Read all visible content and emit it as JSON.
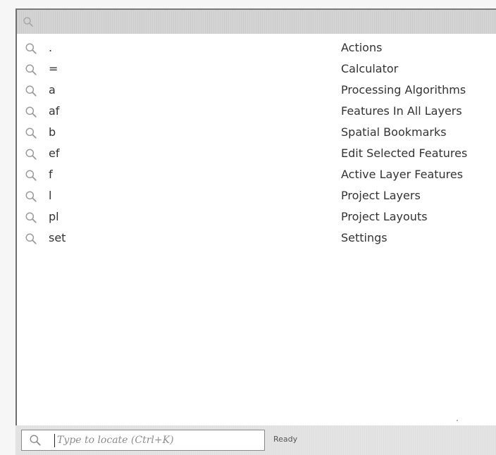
{
  "locator": {
    "placeholder": "Type to locate (Ctrl+K)",
    "value": ""
  },
  "status": {
    "text": "Ready"
  },
  "icons": {
    "search": "search-icon"
  },
  "colors": {
    "text": "#333333",
    "search_icon": "#9a9a9a",
    "header_strip": "#d4d4d4"
  },
  "filters": [
    {
      "prefix": ".",
      "description": "Actions"
    },
    {
      "prefix": "=",
      "description": "Calculator"
    },
    {
      "prefix": "a",
      "description": "Processing Algorithms"
    },
    {
      "prefix": "af",
      "description": "Features In All Layers"
    },
    {
      "prefix": "b",
      "description": "Spatial Bookmarks"
    },
    {
      "prefix": "ef",
      "description": "Edit Selected Features"
    },
    {
      "prefix": "f",
      "description": "Active Layer Features"
    },
    {
      "prefix": "l",
      "description": "Project Layers"
    },
    {
      "prefix": "pl",
      "description": "Project Layouts"
    },
    {
      "prefix": "set",
      "description": "Settings"
    }
  ]
}
